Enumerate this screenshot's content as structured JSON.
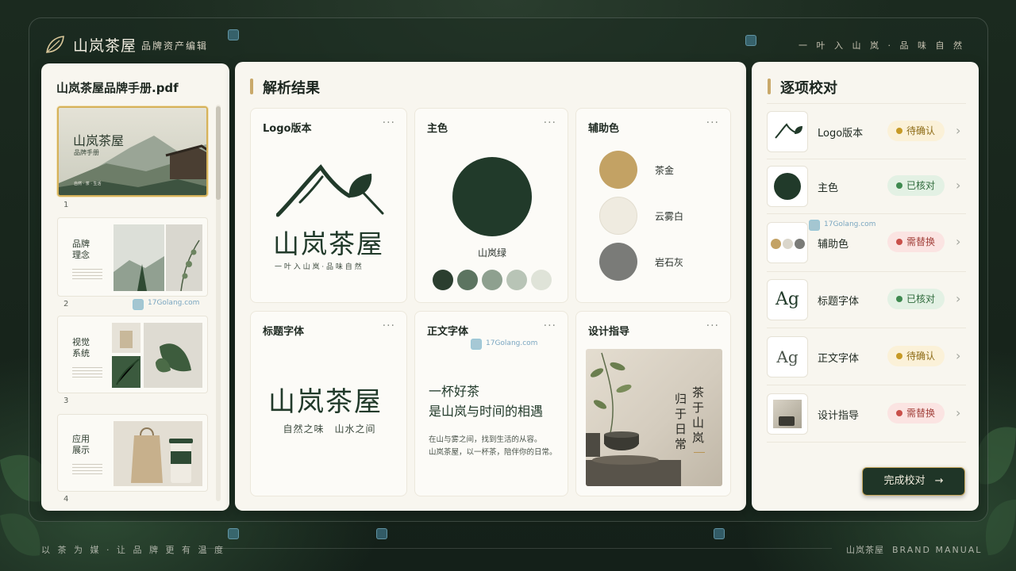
{
  "header": {
    "app_title": "山岚茶屋",
    "app_subtitle": "品牌资产编辑",
    "tagline": "一 叶 入 山 岚 · 品 味 自 然",
    "watermark": "17Golang.com"
  },
  "left": {
    "file_name": "山岚茶屋品牌手册.pdf",
    "pages": [
      {
        "num": "1",
        "title": "山岚茶屋",
        "subtitle": "品牌手册",
        "caption": "自然 · 茶 · 生活"
      },
      {
        "num": "2",
        "title": "品牌\n理念"
      },
      {
        "num": "3",
        "title": "视觉\n系统"
      },
      {
        "num": "4",
        "title": "应用\n展示"
      }
    ]
  },
  "middle": {
    "title": "解析结果",
    "cards": {
      "logo": {
        "title": "Logo版本",
        "more": "···",
        "wordmark": "山岚茶屋",
        "slogan": "一 叶 入 山 岚 · 品 味 自 然"
      },
      "primary": {
        "title": "主色",
        "more": "···",
        "color_name": "山岚绿",
        "color": "#213a2a",
        "tints": [
          "#2b3e2f",
          "#5c7460",
          "#8ea08f",
          "#b8c4b6",
          "#dfe3d8"
        ]
      },
      "secondary": {
        "title": "辅助色",
        "more": "···",
        "colors": [
          {
            "name": "茶金",
            "color": "#c3a264"
          },
          {
            "name": "云雾白",
            "color": "#efebe0"
          },
          {
            "name": "岩石灰",
            "color": "#7a7b78"
          }
        ]
      },
      "heading_font": {
        "title": "标题字体",
        "more": "···",
        "sample": "山岚茶屋",
        "sub": "自然之味　山水之间"
      },
      "body_font": {
        "title": "正文字体",
        "more": "···",
        "line1": "一杯好茶",
        "line2": "是山岚与时间的相遇",
        "para1": "在山与雾之间，找到生活的从容。",
        "para2": "山岚茶屋，以一杯茶，陪伴你的日常。"
      },
      "guide": {
        "title": "设计指导",
        "more": "···",
        "v1": "茶于山岚",
        "v2": "归于日常"
      }
    }
  },
  "right": {
    "title": "逐项校对",
    "items": [
      {
        "label": "Logo版本",
        "status": "待确认"
      },
      {
        "label": "主色",
        "status": "已核对"
      },
      {
        "label": "辅助色",
        "status": "需替换"
      },
      {
        "label": "标题字体",
        "status": "已核对",
        "icon_text": "Ag"
      },
      {
        "label": "正文字体",
        "status": "待确认",
        "icon_text": "Ag"
      },
      {
        "label": "设计指导",
        "status": "需替换"
      }
    ],
    "done_button": "完成校对",
    "chevron": "›",
    "arrow": "→"
  },
  "footer": {
    "slogan": "以 茶 为 媒 · 让 品 牌 更 有 温 度",
    "brand": "山岚茶屋",
    "brand_en": "BRAND MANUAL"
  },
  "colors": {
    "accent_gold": "#c9a96a",
    "primary_green": "#213a2a"
  }
}
